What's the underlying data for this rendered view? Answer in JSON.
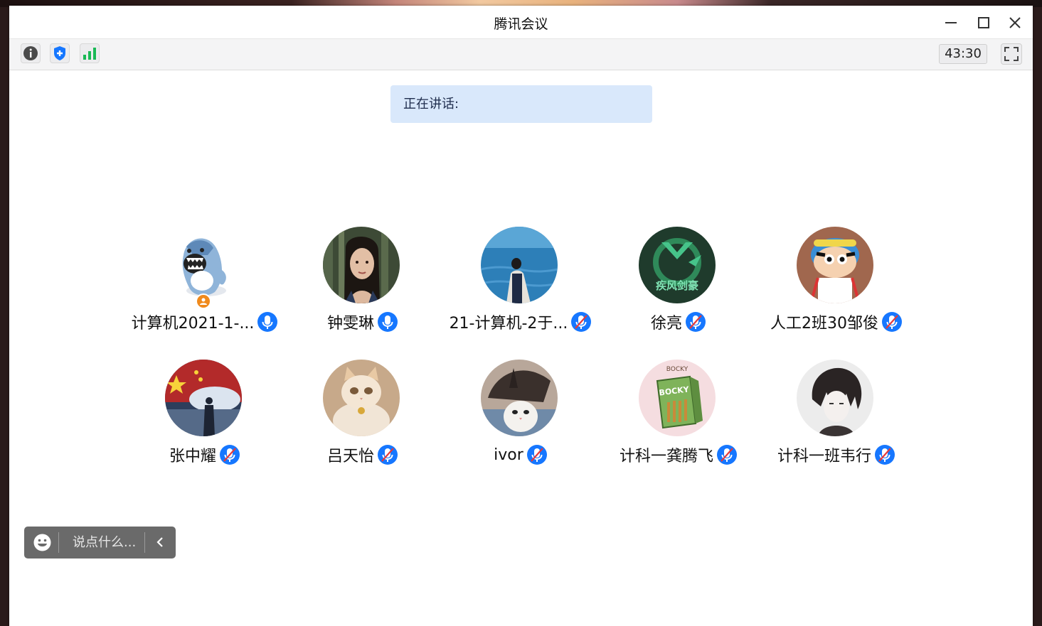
{
  "window": {
    "title": "腾讯会议"
  },
  "toolbar": {
    "timer": "43:30"
  },
  "speaking": {
    "label": "正在讲话:"
  },
  "participants": [
    {
      "name": "计算机2021-1-...",
      "mic": "on",
      "host": true,
      "avatar": "shark-avatar"
    },
    {
      "name": "钟雯琳",
      "mic": "on",
      "host": false,
      "avatar": "woman-portrait-avatar"
    },
    {
      "name": "21-计算机-2于...",
      "mic": "muted",
      "host": false,
      "avatar": "sea-avatar"
    },
    {
      "name": "徐亮",
      "mic": "muted",
      "host": false,
      "avatar": "game-logo-avatar",
      "avatar_text": "疾风剑豪"
    },
    {
      "name": "人工2班30邹俊",
      "mic": "muted",
      "host": false,
      "avatar": "cartoon-boy-avatar"
    },
    {
      "name": "张中耀",
      "mic": "muted",
      "host": false,
      "avatar": "flag-soldier-avatar"
    },
    {
      "name": "吕天怡",
      "mic": "muted",
      "host": false,
      "avatar": "cat-avatar"
    },
    {
      "name": "ivor",
      "mic": "muted",
      "host": false,
      "avatar": "cat-hat-avatar"
    },
    {
      "name": "计科一龚腾飞",
      "mic": "muted",
      "host": false,
      "avatar": "snack-box-avatar",
      "avatar_text": "BOCKY"
    },
    {
      "name": "计科一班韦行",
      "mic": "muted",
      "host": false,
      "avatar": "anime-sketch-avatar"
    }
  ],
  "chat": {
    "placeholder": "说点什么..."
  },
  "colors": {
    "accent": "#1677ff",
    "host": "#f08a1c",
    "speaking_bg": "#d9e8fb"
  }
}
